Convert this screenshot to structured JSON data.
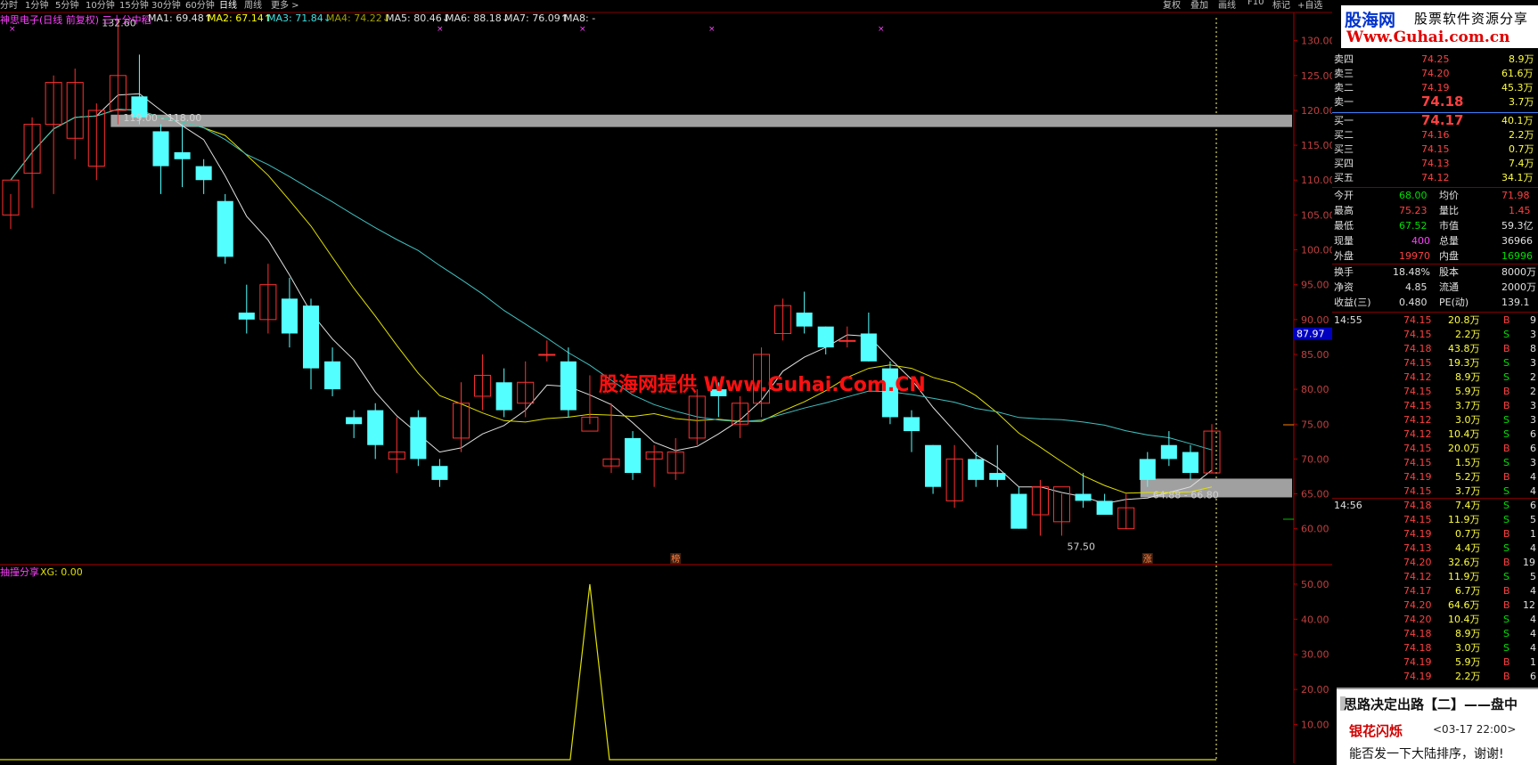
{
  "period_tabs": [
    "分时",
    "1分钟",
    "5分钟",
    "10分钟",
    "15分钟",
    "30分钟",
    "60分钟",
    "日线",
    "周线",
    "更多 >"
  ],
  "active_tab": "日线",
  "right_tabs": [
    "复权",
    "叠加",
    "画线",
    "F10",
    "标记",
    "+自选"
  ],
  "indicator_header": {
    "stock": "神思电子(日线 前复权) 三十分中稻",
    "ma": [
      {
        "label": "MA1: 69.48",
        "arrow": "↑",
        "color": "#e0e0e0"
      },
      {
        "label": "MA2: 67.14",
        "arrow": "↑",
        "color": "#ffff00"
      },
      {
        "label": "MA3: 71.84",
        "arrow": "↓",
        "color": "#40e0e0"
      },
      {
        "label": "MA4: 74.22",
        "arrow": "↓",
        "color": "#a0a000"
      },
      {
        "label": "MA5: 80.46",
        "arrow": "↓",
        "color": "#e0e0e0"
      },
      {
        "label": "MA6: 88.18",
        "arrow": "↓",
        "color": "#e0e0e0"
      },
      {
        "label": "MA7: 76.09",
        "arrow": "↑",
        "color": "#e0e0e0"
      },
      {
        "label": "MA8: -",
        "arrow": "",
        "color": "#e0e0e0"
      }
    ]
  },
  "sub_header": {
    "name": "抽撞分享",
    "xg": "XG: 0.00"
  },
  "chart_data": {
    "type": "candlestick",
    "ylim": [
      56,
      132
    ],
    "y_ticks": [
      "130.00",
      "125.00",
      "120.00",
      "115.00",
      "110.00",
      "105.00",
      "100.00",
      "95.00",
      "90.00",
      "85.00",
      "80.00",
      "75.00",
      "70.00",
      "65.00",
      "60.00"
    ],
    "current_price_label": "87.97",
    "annotations": [
      {
        "text": "132.60",
        "bar": 4,
        "price": 132.6
      },
      {
        "text": "119.00 - 118.00",
        "bar": 5,
        "price": 119.0
      },
      {
        "text": "64.88 - 66.80",
        "bar": 53,
        "price": 64.9
      },
      {
        "text": "57.50",
        "bar": 49,
        "price": 57.5
      }
    ],
    "markers": [
      {
        "text": "榜",
        "bar": 31
      },
      {
        "text": "涨",
        "bar": 53
      }
    ],
    "resistance_zones": [
      {
        "from": 118.0,
        "to": 119.0,
        "start_bar": 5
      },
      {
        "from": 64.88,
        "to": 66.8,
        "start_bar": 53
      }
    ],
    "candles": [
      [
        105,
        110,
        103,
        108
      ],
      [
        111,
        118,
        106,
        119
      ],
      [
        118,
        124,
        108,
        125
      ],
      [
        116,
        124,
        113,
        126
      ],
      [
        112,
        120,
        110,
        121
      ],
      [
        120,
        125,
        118,
        133
      ],
      [
        122,
        119,
        118,
        128
      ],
      [
        117,
        112,
        108,
        118
      ],
      [
        114,
        113,
        109,
        118
      ],
      [
        112,
        110,
        108,
        113
      ],
      [
        107,
        99,
        98,
        108
      ],
      [
        91,
        90,
        88,
        95
      ],
      [
        90,
        95,
        88,
        98
      ],
      [
        93,
        88,
        86,
        96
      ],
      [
        92,
        83,
        80,
        93
      ],
      [
        84,
        80,
        79,
        86
      ],
      [
        76,
        75,
        73,
        77
      ],
      [
        77,
        72,
        70,
        78
      ],
      [
        70,
        71,
        68,
        76
      ],
      [
        76,
        70,
        69,
        77
      ],
      [
        69,
        67,
        66,
        70
      ],
      [
        73,
        78,
        71,
        81
      ],
      [
        79,
        82,
        77,
        85
      ],
      [
        81,
        77,
        76,
        83
      ],
      [
        78,
        81,
        76,
        84
      ],
      [
        85,
        85,
        84,
        87
      ],
      [
        84,
        77,
        76,
        86
      ],
      [
        74,
        76,
        75,
        82
      ],
      [
        69,
        70,
        68,
        78
      ],
      [
        73,
        68,
        67,
        74
      ],
      [
        70,
        71,
        66,
        72
      ],
      [
        68,
        71,
        67,
        73
      ],
      [
        73,
        79,
        72,
        80
      ],
      [
        80,
        79,
        76,
        81
      ],
      [
        75,
        78,
        73,
        79
      ],
      [
        78,
        85,
        76,
        86
      ],
      [
        88,
        92,
        87,
        93
      ],
      [
        91,
        89,
        88,
        94
      ],
      [
        89,
        86,
        85,
        89
      ],
      [
        87,
        87,
        86,
        89
      ],
      [
        88,
        84,
        84,
        91
      ],
      [
        83,
        76,
        75,
        84
      ],
      [
        76,
        74,
        71,
        77
      ],
      [
        72,
        66,
        65,
        72
      ],
      [
        64,
        70,
        63,
        72
      ],
      [
        70,
        67,
        66,
        71
      ],
      [
        68,
        67,
        66,
        72
      ],
      [
        65,
        60,
        60,
        66
      ],
      [
        62,
        66,
        59,
        67
      ],
      [
        61,
        66,
        59,
        65
      ],
      [
        65,
        64,
        63,
        68
      ],
      [
        64,
        62,
        62,
        65
      ],
      [
        60,
        63,
        60,
        65
      ],
      [
        70,
        67,
        66,
        71
      ],
      [
        72,
        70,
        69,
        74
      ],
      [
        71,
        68,
        67,
        72
      ],
      [
        68,
        74,
        68,
        75
      ]
    ],
    "ma_lines_description": "MA1 white, MA2 yellow, MA3 cyan",
    "sub_indicator": {
      "y_ticks": [
        "50.00",
        "40.00",
        "30.00",
        "20.00",
        "10.00"
      ],
      "ylim": [
        0,
        52
      ],
      "spike": {
        "bar": 27,
        "value": 50
      }
    }
  },
  "quote": {
    "asks": [
      {
        "label": "卖四",
        "price": "74.25",
        "vol": "8.9万"
      },
      {
        "label": "卖三",
        "price": "74.20",
        "vol": "61.6万"
      },
      {
        "label": "卖二",
        "price": "74.19",
        "vol": "45.3万"
      },
      {
        "label": "卖一",
        "price": "74.18",
        "vol": "3.7万"
      }
    ],
    "bids": [
      {
        "label": "买一",
        "price": "74.17",
        "vol": "40.1万"
      },
      {
        "label": "买二",
        "price": "74.16",
        "vol": "2.2万"
      },
      {
        "label": "买三",
        "price": "74.15",
        "vol": "0.7万"
      },
      {
        "label": "买四",
        "price": "74.13",
        "vol": "7.4万"
      },
      {
        "label": "买五",
        "price": "74.12",
        "vol": "34.1万"
      }
    ],
    "stats": [
      {
        "l1": "今开",
        "v1": "68.00",
        "c1": "green",
        "l2": "均价",
        "v2": "71.98",
        "c2": "red"
      },
      {
        "l1": "最高",
        "v1": "75.23",
        "c1": "red",
        "l2": "量比",
        "v2": "1.45",
        "c2": "red"
      },
      {
        "l1": "最低",
        "v1": "67.52",
        "c1": "green",
        "l2": "市值",
        "v2": "59.3亿",
        "c2": "white"
      },
      {
        "l1": "现量",
        "v1": "400",
        "c1": "purple",
        "l2": "总量",
        "v2": "36966",
        "c2": "white"
      },
      {
        "l1": "外盘",
        "v1": "19970",
        "c1": "red",
        "l2": "内盘",
        "v2": "16996",
        "c2": "green"
      }
    ],
    "stats2": [
      {
        "l1": "换手",
        "v1": "18.48%",
        "l2": "股本",
        "v2": "8000万"
      },
      {
        "l1": "净资",
        "v1": "4.85",
        "l2": "流通",
        "v2": "2000万"
      },
      {
        "l1": "收益(三)",
        "v1": "0.480",
        "l2": "PE(动)",
        "v2": "139.1"
      }
    ]
  },
  "ticks": [
    {
      "time": "14:55",
      "price": "74.15",
      "vol": "20.8万",
      "side": "B",
      "n": "9"
    },
    {
      "time": "",
      "price": "74.15",
      "vol": "2.2万",
      "side": "S",
      "n": "3"
    },
    {
      "time": "",
      "price": "74.18",
      "vol": "43.8万",
      "side": "B",
      "n": "8"
    },
    {
      "time": "",
      "price": "74.15",
      "vol": "19.3万",
      "side": "S",
      "n": "3"
    },
    {
      "time": "",
      "price": "74.12",
      "vol": "8.9万",
      "side": "S",
      "n": "2"
    },
    {
      "time": "",
      "price": "74.15",
      "vol": "5.9万",
      "side": "B",
      "n": "2"
    },
    {
      "time": "",
      "price": "74.15",
      "vol": "3.7万",
      "side": "B",
      "n": "3"
    },
    {
      "time": "",
      "price": "74.12",
      "vol": "3.0万",
      "side": "S",
      "n": "3"
    },
    {
      "time": "",
      "price": "74.12",
      "vol": "10.4万",
      "side": "S",
      "n": "6"
    },
    {
      "time": "",
      "price": "74.15",
      "vol": "20.0万",
      "side": "B",
      "n": "6"
    },
    {
      "time": "",
      "price": "74.15",
      "vol": "1.5万",
      "side": "S",
      "n": "3"
    },
    {
      "time": "",
      "price": "74.19",
      "vol": "5.2万",
      "side": "B",
      "n": "4"
    },
    {
      "time": "",
      "price": "74.15",
      "vol": "3.7万",
      "side": "S",
      "n": "4"
    },
    {
      "time": "14:56",
      "price": "74.18",
      "vol": "7.4万",
      "side": "S",
      "n": "6"
    },
    {
      "time": "",
      "price": "74.15",
      "vol": "11.9万",
      "side": "S",
      "n": "5"
    },
    {
      "time": "",
      "price": "74.19",
      "vol": "0.7万",
      "side": "B",
      "n": "1"
    },
    {
      "time": "",
      "price": "74.13",
      "vol": "4.4万",
      "side": "S",
      "n": "4"
    },
    {
      "time": "",
      "price": "74.20",
      "vol": "32.6万",
      "side": "B",
      "n": "19"
    },
    {
      "time": "",
      "price": "74.12",
      "vol": "11.9万",
      "side": "S",
      "n": "5"
    },
    {
      "time": "",
      "price": "74.17",
      "vol": "6.7万",
      "side": "B",
      "n": "4"
    },
    {
      "time": "",
      "price": "74.20",
      "vol": "64.6万",
      "side": "B",
      "n": "12"
    },
    {
      "time": "",
      "price": "74.20",
      "vol": "10.4万",
      "side": "S",
      "n": "4"
    },
    {
      "time": "",
      "price": "74.18",
      "vol": "8.9万",
      "side": "S",
      "n": "4"
    },
    {
      "time": "",
      "price": "74.18",
      "vol": "3.0万",
      "side": "S",
      "n": "4"
    },
    {
      "time": "",
      "price": "74.19",
      "vol": "5.9万",
      "side": "B",
      "n": "1"
    },
    {
      "time": "",
      "price": "74.19",
      "vol": "2.2万",
      "side": "B",
      "n": "6"
    }
  ],
  "logo": {
    "name": "股海网",
    "tagline": "股票软件资源分享",
    "url": "Www.Guhai.com.cn"
  },
  "watermark": "股海网提供 Www.Guhai.Com.CN",
  "popup": {
    "title": "思路决定出路【二】——盘中",
    "author": "银花闪烁",
    "time": "<03-17 22:00>",
    "message": "能否发一下大陆排序，谢谢!"
  }
}
